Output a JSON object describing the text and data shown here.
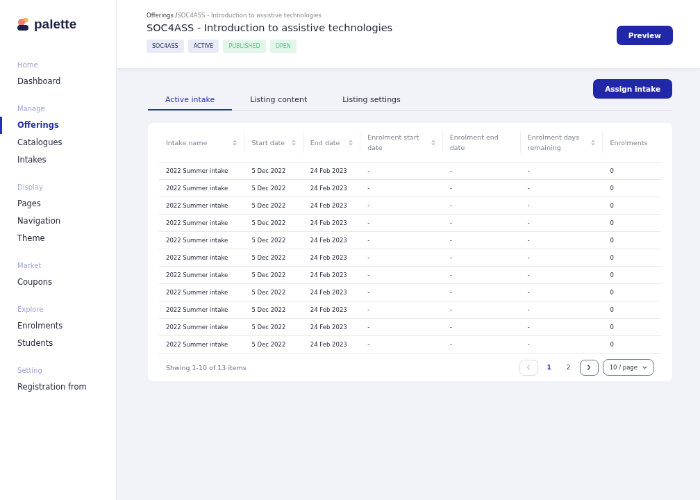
{
  "logo": {
    "text": "palette"
  },
  "sidebar": {
    "sections": [
      {
        "title": "Home",
        "items": [
          {
            "label": "Dashboard",
            "selected": false
          }
        ]
      },
      {
        "title": "Manage",
        "items": [
          {
            "label": "Offerings",
            "selected": true
          },
          {
            "label": "Catalogues",
            "selected": false
          },
          {
            "label": "Intakes",
            "selected": false
          }
        ]
      },
      {
        "title": "Display",
        "items": [
          {
            "label": "Pages",
            "selected": false
          },
          {
            "label": "Navigation",
            "selected": false
          },
          {
            "label": "Theme",
            "selected": false
          }
        ]
      },
      {
        "title": "Market",
        "items": [
          {
            "label": "Coupons",
            "selected": false
          }
        ]
      },
      {
        "title": "Explore",
        "items": [
          {
            "label": "Enrolments",
            "selected": false
          },
          {
            "label": "Students",
            "selected": false
          }
        ]
      },
      {
        "title": "Setting",
        "items": [
          {
            "label": "Registration from",
            "selected": false
          }
        ]
      }
    ]
  },
  "header": {
    "breadcrumb": {
      "parent": "Offerings /",
      "current": "SOC4ASS - Introduction to assistive technologies"
    },
    "title": "SOC4ASS - Introduction to assistive technologies",
    "tags": [
      {
        "label": "SOC4ASS",
        "kind": "neutral"
      },
      {
        "label": "ACTIVE",
        "kind": "neutral"
      },
      {
        "label": "PUBLISHED",
        "kind": "success"
      },
      {
        "label": "OPEN",
        "kind": "success"
      }
    ],
    "preview_button": "Preview"
  },
  "assign_button": "Assign intake",
  "tabs": [
    {
      "label": "Active intake",
      "selected": true
    },
    {
      "label": "Listing content",
      "selected": false
    },
    {
      "label": "Listing settings",
      "selected": false
    }
  ],
  "table": {
    "columns": [
      {
        "label": "Intake name",
        "sortable": true
      },
      {
        "label": "Start date",
        "sortable": true
      },
      {
        "label": "End date",
        "sortable": true
      },
      {
        "label": "Enrolment start date",
        "sortable": true
      },
      {
        "label": "Enrolment end date",
        "sortable": false
      },
      {
        "label": "Enrolment days remaining",
        "sortable": true
      },
      {
        "label": "Enrolments",
        "sortable": false
      }
    ],
    "rows": [
      [
        "2022 Summer intake",
        "5 Dec 2022",
        "24 Feb 2023",
        "-",
        "-",
        "-",
        "0"
      ],
      [
        "2022 Summer intake",
        "5 Dec 2022",
        "24 Feb 2023",
        "-",
        "-",
        "-",
        "0"
      ],
      [
        "2022 Summer intake",
        "5 Dec 2022",
        "24 Feb 2023",
        "-",
        "-",
        "-",
        "0"
      ],
      [
        "2022 Summer intake",
        "5 Dec 2022",
        "24 Feb 2023",
        "-",
        "-",
        "-",
        "0"
      ],
      [
        "2022 Summer intake",
        "5 Dec 2022",
        "24 Feb 2023",
        "-",
        "-",
        "-",
        "0"
      ],
      [
        "2022 Summer intake",
        "5 Dec 2022",
        "24 Feb 2023",
        "-",
        "-",
        "-",
        "0"
      ],
      [
        "2022 Summer intake",
        "5 Dec 2022",
        "24 Feb 2023",
        "-",
        "-",
        "-",
        "0"
      ],
      [
        "2022 Summer intake",
        "5 Dec 2022",
        "24 Feb 2023",
        "-",
        "-",
        "-",
        "0"
      ],
      [
        "2022 Summer intake",
        "5 Dec 2022",
        "24 Feb 2023",
        "-",
        "-",
        "-",
        "0"
      ],
      [
        "2022 Summer intake",
        "5 Dec 2022",
        "24 Feb 2023",
        "-",
        "-",
        "-",
        "0"
      ],
      [
        "2022 Summer intake",
        "5 Dec 2022",
        "24 Feb 2023",
        "-",
        "-",
        "-",
        "0"
      ]
    ]
  },
  "pagination": {
    "summary": "Shwing 1-10 of 13 items",
    "prev_disabled": true,
    "next_disabled": false,
    "pages": [
      {
        "label": "1",
        "selected": true
      },
      {
        "label": "2",
        "selected": false
      }
    ],
    "page_size": "10 / page"
  }
}
